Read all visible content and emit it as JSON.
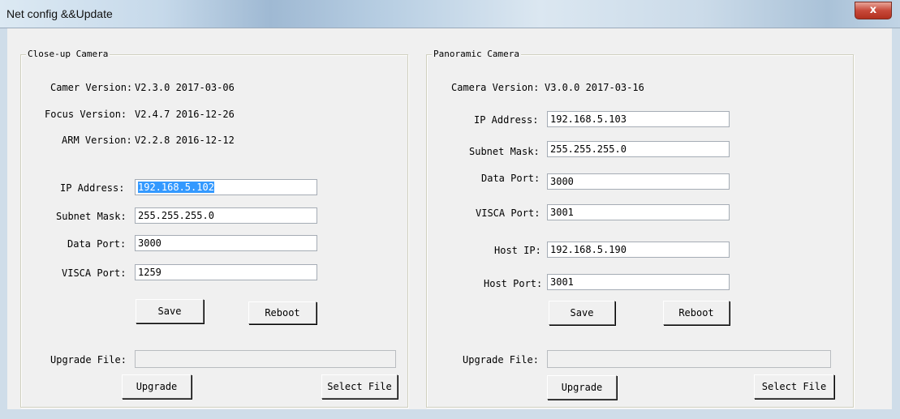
{
  "window": {
    "title": "Net config &&Update",
    "close_glyph": "x"
  },
  "left": {
    "title": "Close-up Camera",
    "camera_version_label": "Camer Version:",
    "camera_version": "V2.3.0 2017-03-06",
    "focus_version_label": "Focus Version:",
    "focus_version": "V2.4.7 2016-12-26",
    "arm_version_label": "ARM Version:",
    "arm_version": "V2.2.8 2016-12-12",
    "ip_label": "IP Address:",
    "ip_value": "192.168.5.102",
    "mask_label": "Subnet Mask:",
    "mask_value": "255.255.255.0",
    "data_port_label": "Data Port:",
    "data_port_value": "3000",
    "visca_port_label": "VISCA Port:",
    "visca_port_value": "1259",
    "save_label": "Save",
    "reboot_label": "Reboot",
    "upgrade_file_label": "Upgrade File:",
    "upgrade_file_value": "",
    "upgrade_label": "Upgrade",
    "select_file_label": "Select File"
  },
  "right": {
    "title": "Panoramic Camera",
    "camera_version_label": "Camera Version:",
    "camera_version": "V3.0.0 2017-03-16",
    "ip_label": "IP Address:",
    "ip_value": "192.168.5.103",
    "mask_label": "Subnet Mask:",
    "mask_value": "255.255.255.0",
    "data_port_label": "Data Port:",
    "data_port_value": "3000",
    "visca_port_label": "VISCA Port:",
    "visca_port_value": "3001",
    "host_ip_label": "Host IP:",
    "host_ip_value": "192.168.5.190",
    "host_port_label": "Host Port:",
    "host_port_value": "3001",
    "save_label": "Save",
    "reboot_label": "Reboot",
    "upgrade_file_label": "Upgrade File:",
    "upgrade_file_value": "",
    "upgrade_label": "Upgrade",
    "select_file_label": "Select File"
  }
}
